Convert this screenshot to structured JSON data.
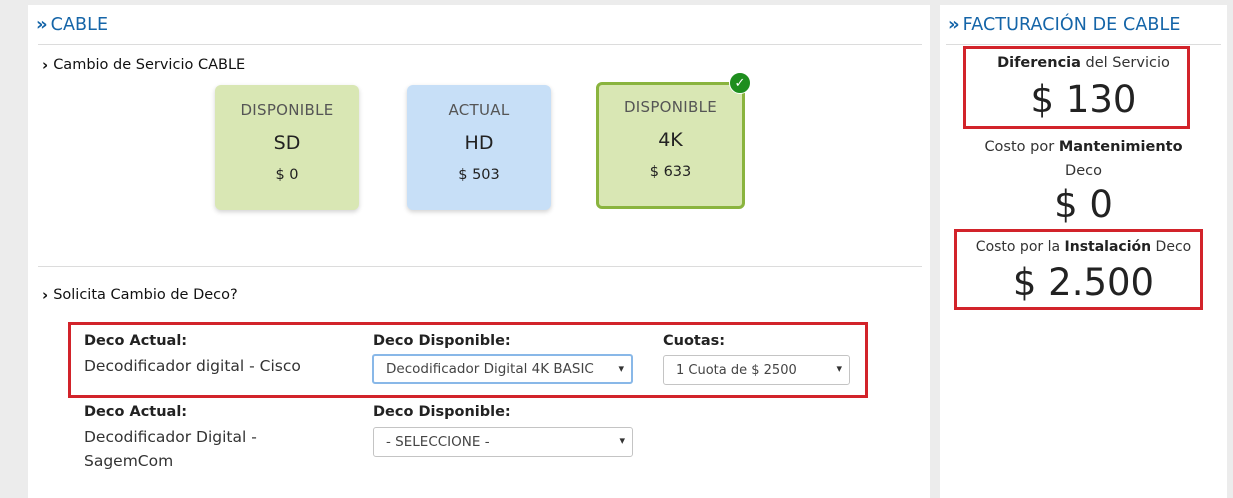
{
  "cable_panel": {
    "title": "CABLE",
    "service_section": {
      "title": "Cambio de Servicio CABLE",
      "cards": [
        {
          "status": "DISPONIBLE",
          "name": "SD",
          "price": "$ 0",
          "color": "#d9e7b4",
          "selected": false
        },
        {
          "status": "ACTUAL",
          "name": "HD",
          "price": "$ 503",
          "color": "#c7dff7",
          "selected": false
        },
        {
          "status": "DISPONIBLE",
          "name": "4K",
          "price": "$ 633",
          "color": "#d9e7b4",
          "selected": true
        }
      ]
    },
    "deco_section": {
      "title": "Solicita Cambio de Deco?",
      "rows": [
        {
          "current_label": "Deco Actual:",
          "current_value": "Decodificador digital - Cisco",
          "available_label": "Deco Disponible:",
          "available_value": "Decodificador Digital 4K BASIC",
          "installments_label": "Cuotas:",
          "installments_value": "1 Cuota de $ 2500"
        },
        {
          "current_label": "Deco Actual:",
          "current_value": "Decodificador Digital - SagemCom",
          "available_label": "Deco Disponible:",
          "available_value": "- SELECCIONE -"
        }
      ]
    }
  },
  "billing_panel": {
    "title": "FACTURACIÓN DE CABLE",
    "service_diff": {
      "label_bold": "Diferencia",
      "label_rest": " del Servicio",
      "amount": "$ 130"
    },
    "maintenance": {
      "label_pre": "Costo por ",
      "label_bold": "Mantenimiento",
      "label_post": "Deco",
      "amount": "$ 0"
    },
    "installation": {
      "label_pre": "Costo por la ",
      "label_bold": "Instalación",
      "label_post": " Deco",
      "amount": "$ 2.500"
    }
  },
  "colors": {
    "accent": "#1565a8",
    "highlight": "#d2232a",
    "selected_border": "#8ab43e",
    "check": "#1e8e1e"
  }
}
